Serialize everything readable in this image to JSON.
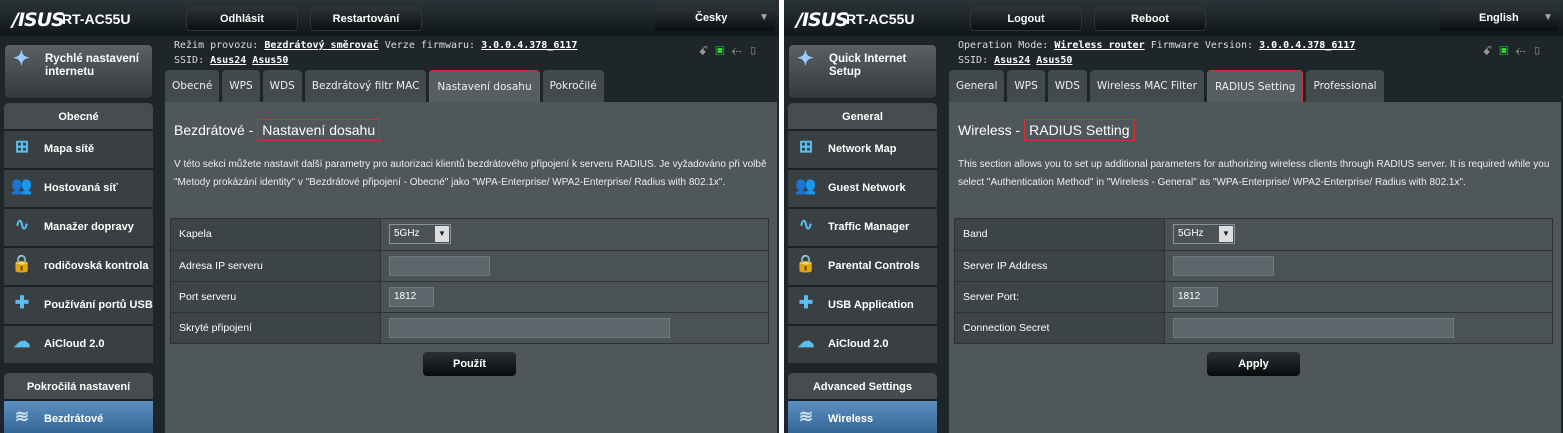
{
  "panels": [
    {
      "logo": "ASUS",
      "model": "RT-AC55U",
      "logout": "Odhlásit",
      "reboot": "Restartování",
      "language": "Česky",
      "op_mode_label": "Režim provozu:",
      "op_mode": "Bezdrátový směrovač",
      "fw_label": "Verze firmwaru:",
      "fw": "3.0.0.4.378_6117",
      "ssid_label": "SSID:",
      "ssid1": "Asus24",
      "ssid2": "Asus50",
      "quick_setup": "Rychlé nastavení internetu",
      "general_header": "Obecné",
      "menu": [
        "Mapa sítě",
        "Hostovaná síť",
        "Manažer dopravy",
        "rodičovská kontrola",
        "Používání portů USB",
        "AiCloud 2.0"
      ],
      "advanced_header": "Pokročilá nastavení",
      "active_item": "Bezdrátové",
      "tabs": [
        "Obecné",
        "WPS",
        "WDS",
        "Bezdrátový filtr MAC",
        "Nastavení dosahu",
        "Pokročilé"
      ],
      "selected_tab": 4,
      "title_prefix": "Bezdrátové -",
      "title": "Nastavení dosahu",
      "description": "V této sekci můžete nastavit další parametry pro autorizaci klientů bezdrátového připojení k serveru RADIUS. Je vyžadováno při volbě \"Metody prokázání identity\" v \"Bezdrátové připojení - Obecné\" jako \"WPA-Enterprise/ WPA2-Enterprise/ Radius with 802.1x\".",
      "fields": {
        "band_label": "Kapela",
        "band_value": "5GHz",
        "ip_label": "Adresa IP serveru",
        "ip_value": "",
        "port_label": "Port serveru",
        "port_value": "1812",
        "secret_label": "Skryté připojení",
        "secret_value": ""
      },
      "apply": "Použít"
    },
    {
      "logo": "ASUS",
      "model": "RT-AC55U",
      "logout": "Logout",
      "reboot": "Reboot",
      "language": "English",
      "op_mode_label": "Operation Mode:",
      "op_mode": "Wireless router",
      "fw_label": "Firmware Version:",
      "fw": "3.0.0.4.378_6117",
      "ssid_label": "SSID:",
      "ssid1": "Asus24",
      "ssid2": "Asus50",
      "quick_setup": "Quick Internet Setup",
      "general_header": "General",
      "menu": [
        "Network Map",
        "Guest Network",
        "Traffic Manager",
        "Parental Controls",
        "USB Application",
        "AiCloud 2.0"
      ],
      "advanced_header": "Advanced Settings",
      "active_item": "Wireless",
      "tabs": [
        "General",
        "WPS",
        "WDS",
        "Wireless MAC Filter",
        "RADIUS Setting",
        "Professional"
      ],
      "selected_tab": 4,
      "title_prefix": "Wireless -",
      "title": "RADIUS Setting",
      "description": "This section allows you to set up additional parameters for authorizing wireless clients through RADIUS server. It is required while you select \"Authentication Method\" in \"Wireless - General\" as \"WPA-Enterprise/ WPA2-Enterprise/ Radius with 802.1x\".",
      "fields": {
        "band_label": "Band",
        "band_value": "5GHz",
        "ip_label": "Server IP Address",
        "ip_value": "",
        "port_label": "Server Port:",
        "port_value": "1812",
        "secret_label": "Connection Secret",
        "secret_value": ""
      },
      "apply": "Apply"
    }
  ],
  "colors": {
    "accent_blue": "#5bc0f0",
    "selected_outline": "#cc3333",
    "status_green": "#33cc33"
  }
}
